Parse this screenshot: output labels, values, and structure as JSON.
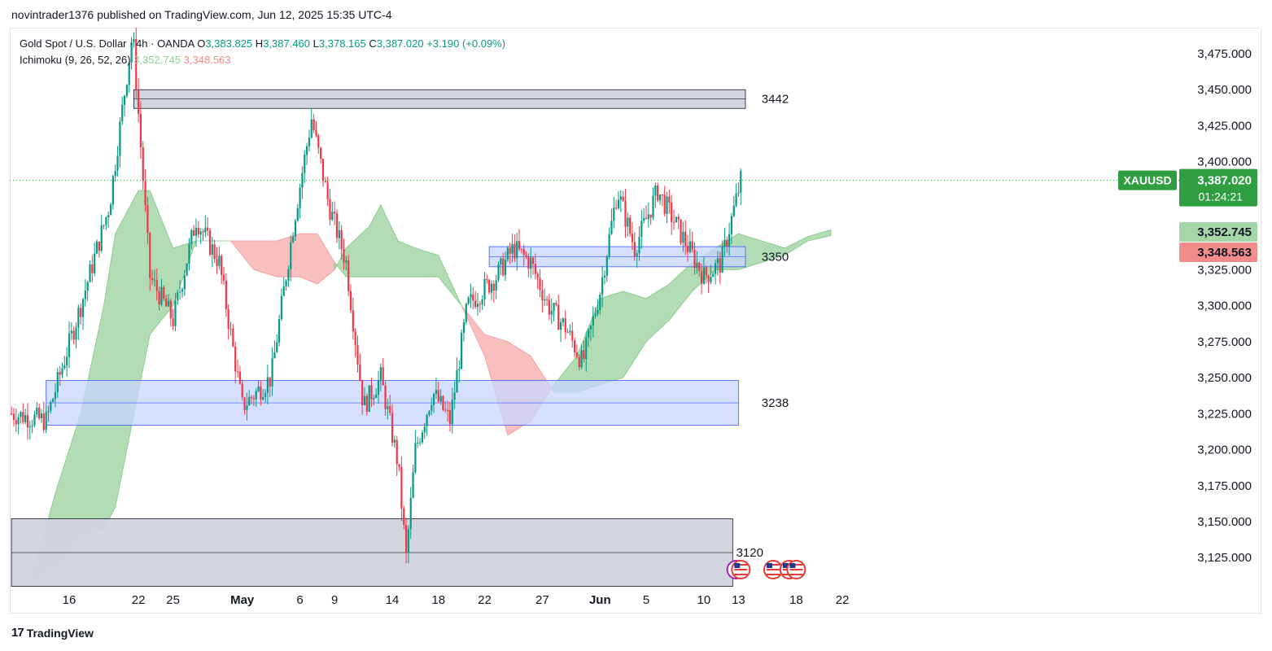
{
  "header": {
    "publisher_line": "novintrader1376 published on TradingView.com, Jun 12, 2025 15:35 UTC-4"
  },
  "legend": {
    "symbol_line": "Gold Spot / U.S. Dollar · 4h · OANDA",
    "o_label": "O",
    "o_value": "3,383.825",
    "h_label": "H",
    "h_value": "3,387.460",
    "l_label": "L",
    "l_value": "3,378.165",
    "c_label": "C",
    "c_value": "3,387.020",
    "change": "+3.190 (+0.09%)",
    "ichimoku_label": "Ichimoku (9, 26, 52, 26)",
    "ichimoku_a": "3,352.745",
    "ichimoku_b": "3,348.563"
  },
  "footer": {
    "brand": "TradingView",
    "logo_glyph": "17"
  },
  "colors": {
    "up": "#089981",
    "down": "#f23645",
    "cloud_green": "#a5d6a7",
    "cloud_red": "#f8b4b4",
    "zone_blue": "#c7d6ff",
    "zone_blue_border": "#3d5afe",
    "zone_gray": "#d1d4dc",
    "price_badge": "#2e9e41"
  },
  "chart_data": {
    "type": "candlestick",
    "symbol": "XAUUSD",
    "timeframe": "4h",
    "ylim": [
      3105,
      3495
    ],
    "y_ticks": [
      3475,
      3450,
      3425,
      3400,
      3375,
      3350,
      3325,
      3300,
      3275,
      3250,
      3225,
      3200,
      3175,
      3150,
      3125
    ],
    "y_tick_labels": [
      "3,475.000",
      "3,450.000",
      "3,425.000",
      "3,400.000",
      "3,375.000",
      "3,350.000",
      "3,325.000",
      "3,300.000",
      "3,275.000",
      "3,250.000",
      "3,225.000",
      "3,200.000",
      "3,175.000",
      "3,150.000",
      "3,125.000"
    ],
    "x_ticks": [
      {
        "label": "16",
        "day": 0
      },
      {
        "label": "22",
        "day": 6
      },
      {
        "label": "25",
        "day": 9
      },
      {
        "label": "May",
        "day": 15,
        "bold": true
      },
      {
        "label": "6",
        "day": 20
      },
      {
        "label": "9",
        "day": 23
      },
      {
        "label": "14",
        "day": 28
      },
      {
        "label": "18",
        "day": 32
      },
      {
        "label": "22",
        "day": 36
      },
      {
        "label": "27",
        "day": 41
      },
      {
        "label": "Jun",
        "day": 46,
        "bold": true
      },
      {
        "label": "5",
        "day": 50
      },
      {
        "label": "10",
        "day": 55
      },
      {
        "label": "13",
        "day": 58
      },
      {
        "label": "18",
        "day": 63
      },
      {
        "label": "22",
        "day": 67
      }
    ],
    "last_price": {
      "label": "XAUUSD",
      "value": 3387.02,
      "value_label": "3,387.020",
      "countdown": "01:24:21"
    },
    "ichimoku_badges": [
      {
        "value": 3352.745,
        "label": "3,352.745",
        "color": "#a5d6a7",
        "text_color": "#131722"
      },
      {
        "value": 3348.563,
        "label": "3,348.563",
        "color": "#f28b8b",
        "text_color": "#131722"
      }
    ],
    "zones": [
      {
        "label": "3442",
        "kind": "gray",
        "top": 3450,
        "bottom": 3437,
        "start_day": 5.6,
        "end_day": 58.6,
        "label_day": 60
      },
      {
        "label": "3350",
        "kind": "blue",
        "top": 3341,
        "bottom": 3327,
        "start_day": 36.4,
        "end_day": 58.6,
        "label_day": 60
      },
      {
        "label": "3238",
        "kind": "blue",
        "top": 3248,
        "bottom": 3217,
        "start_day": -2,
        "end_day": 58,
        "label_day": 60
      },
      {
        "label": "3120",
        "kind": "gray",
        "top": 3152,
        "bottom": 3105,
        "start_day": -5,
        "end_day": 57.5,
        "label_day": 57.8
      }
    ],
    "key_points": [
      {
        "day": -5,
        "price": 3225
      },
      {
        "day": -2,
        "price": 3220
      },
      {
        "day": 1,
        "price": 3300
      },
      {
        "day": 3.5,
        "price": 3370
      },
      {
        "day": 5.5,
        "price": 3490
      },
      {
        "day": 7,
        "price": 3320
      },
      {
        "day": 9,
        "price": 3290
      },
      {
        "day": 11,
        "price": 3360
      },
      {
        "day": 13,
        "price": 3330
      },
      {
        "day": 15,
        "price": 3230
      },
      {
        "day": 17.5,
        "price": 3250
      },
      {
        "day": 19.5,
        "price": 3360
      },
      {
        "day": 21,
        "price": 3430
      },
      {
        "day": 22.5,
        "price": 3370
      },
      {
        "day": 24,
        "price": 3330
      },
      {
        "day": 25.5,
        "price": 3230
      },
      {
        "day": 27,
        "price": 3250
      },
      {
        "day": 28.5,
        "price": 3190
      },
      {
        "day": 29.2,
        "price": 3125
      },
      {
        "day": 30,
        "price": 3200
      },
      {
        "day": 31.5,
        "price": 3240
      },
      {
        "day": 33,
        "price": 3220
      },
      {
        "day": 34.5,
        "price": 3300
      },
      {
        "day": 37,
        "price": 3320
      },
      {
        "day": 38.5,
        "price": 3340
      },
      {
        "day": 40,
        "price": 3330
      },
      {
        "day": 41.5,
        "price": 3300
      },
      {
        "day": 43,
        "price": 3285
      },
      {
        "day": 44.5,
        "price": 3260
      },
      {
        "day": 46,
        "price": 3310
      },
      {
        "day": 47.5,
        "price": 3380
      },
      {
        "day": 49,
        "price": 3340
      },
      {
        "day": 51,
        "price": 3380
      },
      {
        "day": 53,
        "price": 3350
      },
      {
        "day": 55,
        "price": 3320
      },
      {
        "day": 56.5,
        "price": 3330
      },
      {
        "day": 58.2,
        "price": 3387
      }
    ],
    "cloud_a": [
      {
        "day": -3.5,
        "price": 3105
      },
      {
        "day": -1,
        "price": 3175
      },
      {
        "day": 1,
        "price": 3225
      },
      {
        "day": 3,
        "price": 3300
      },
      {
        "day": 4,
        "price": 3350
      },
      {
        "day": 6,
        "price": 3380
      },
      {
        "day": 7,
        "price": 3380
      },
      {
        "day": 9,
        "price": 3340
      },
      {
        "day": 11,
        "price": 3345
      },
      {
        "day": 12,
        "price": 3345
      },
      {
        "day": 14,
        "price": 3345
      },
      {
        "day": 16,
        "price": 3325
      },
      {
        "day": 18,
        "price": 3320
      },
      {
        "day": 20,
        "price": 3320
      },
      {
        "day": 21.5,
        "price": 3315
      },
      {
        "day": 23,
        "price": 3325
      },
      {
        "day": 24,
        "price": 3340
      },
      {
        "day": 26,
        "price": 3355
      },
      {
        "day": 27,
        "price": 3370
      },
      {
        "day": 28.5,
        "price": 3345
      },
      {
        "day": 30,
        "price": 3340
      },
      {
        "day": 32,
        "price": 3335
      },
      {
        "day": 34,
        "price": 3300
      },
      {
        "day": 36,
        "price": 3265
      },
      {
        "day": 38,
        "price": 3210
      },
      {
        "day": 40,
        "price": 3220
      },
      {
        "day": 42,
        "price": 3245
      },
      {
        "day": 44,
        "price": 3265
      },
      {
        "day": 46,
        "price": 3305
      },
      {
        "day": 48,
        "price": 3310
      },
      {
        "day": 50,
        "price": 3305
      },
      {
        "day": 52,
        "price": 3315
      },
      {
        "day": 54,
        "price": 3330
      },
      {
        "day": 56,
        "price": 3340
      },
      {
        "day": 58,
        "price": 3350
      },
      {
        "day": 60,
        "price": 3345
      },
      {
        "day": 62,
        "price": 3340
      },
      {
        "day": 64,
        "price": 3348
      },
      {
        "day": 66,
        "price": 3352.7
      }
    ],
    "cloud_b": [
      {
        "day": -3.5,
        "price": 3105
      },
      {
        "day": -1,
        "price": 3120
      },
      {
        "day": 1,
        "price": 3140
      },
      {
        "day": 3,
        "price": 3145
      },
      {
        "day": 4,
        "price": 3160
      },
      {
        "day": 6,
        "price": 3240
      },
      {
        "day": 7,
        "price": 3280
      },
      {
        "day": 9,
        "price": 3300
      },
      {
        "day": 11,
        "price": 3345
      },
      {
        "day": 12,
        "price": 3345
      },
      {
        "day": 14,
        "price": 3345
      },
      {
        "day": 16,
        "price": 3345
      },
      {
        "day": 18,
        "price": 3345
      },
      {
        "day": 20,
        "price": 3350
      },
      {
        "day": 21.5,
        "price": 3350
      },
      {
        "day": 23,
        "price": 3330
      },
      {
        "day": 24,
        "price": 3320
      },
      {
        "day": 26,
        "price": 3320
      },
      {
        "day": 27,
        "price": 3320
      },
      {
        "day": 28.5,
        "price": 3320
      },
      {
        "day": 30,
        "price": 3320
      },
      {
        "day": 32,
        "price": 3320
      },
      {
        "day": 34,
        "price": 3300
      },
      {
        "day": 36,
        "price": 3280
      },
      {
        "day": 38,
        "price": 3275
      },
      {
        "day": 40,
        "price": 3265
      },
      {
        "day": 42,
        "price": 3240
      },
      {
        "day": 44,
        "price": 3240
      },
      {
        "day": 46,
        "price": 3245
      },
      {
        "day": 48,
        "price": 3250
      },
      {
        "day": 50,
        "price": 3275
      },
      {
        "day": 52,
        "price": 3290
      },
      {
        "day": 54,
        "price": 3310
      },
      {
        "day": 56,
        "price": 3325
      },
      {
        "day": 58,
        "price": 3325
      },
      {
        "day": 60,
        "price": 3330
      },
      {
        "day": 62,
        "price": 3335
      },
      {
        "day": 64,
        "price": 3345
      },
      {
        "day": 66,
        "price": 3348.6
      }
    ],
    "event_icons": [
      {
        "day": 57.8,
        "kind": "lightning"
      },
      {
        "day": 58.2,
        "kind": "flag-us"
      },
      {
        "day": 61,
        "kind": "flag-us"
      },
      {
        "day": 62.4,
        "kind": "flag-us"
      },
      {
        "day": 63,
        "kind": "flag-us"
      }
    ]
  }
}
